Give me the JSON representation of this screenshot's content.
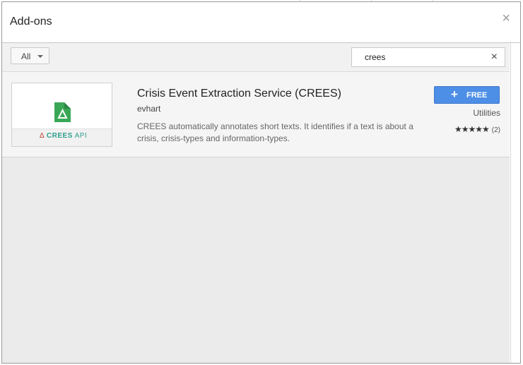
{
  "dialog": {
    "title": "Add-ons",
    "close_glyph": "×"
  },
  "toolbar": {
    "filter_label": "All",
    "search_value": "crees",
    "clear_glyph": "×"
  },
  "result": {
    "title": "Crisis Event Extraction Service (CREES)",
    "author": "evhart",
    "description": "CREES automatically annotates short texts. It identifies if a text is about a crisis, crisis-types and information-types.",
    "button_label": "FREE",
    "button_glyph": "+",
    "category": "Utilities",
    "stars": "★★★★★",
    "rating_count": "(2)",
    "rating_value": 5,
    "thumbnail": {
      "brand_mark": "Δ",
      "brand_word1": "CREES",
      "brand_word2": "API",
      "logo_color": "#3aa757",
      "brand_red": "#c0392b",
      "brand_teal": "#2e9f8f"
    }
  },
  "colors": {
    "accent_button": "#4d8ee6",
    "toolbar_bg": "#f1f1f1",
    "content_bg": "#ebebeb"
  }
}
